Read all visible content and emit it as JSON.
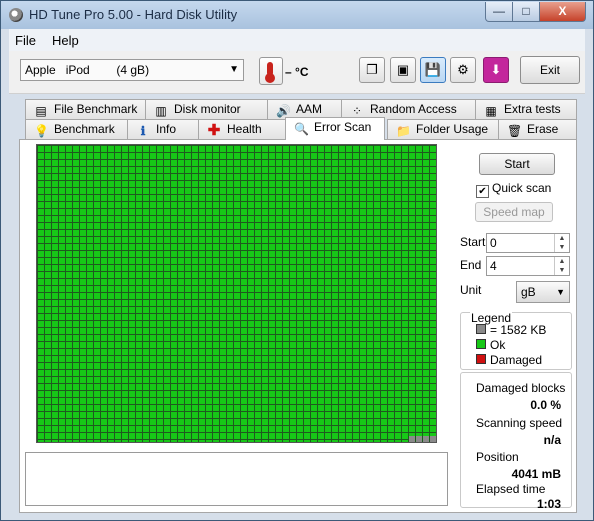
{
  "window": {
    "title": "HD Tune Pro 5.00 - Hard Disk Utility",
    "minimize": "—",
    "maximize": "□",
    "close": "X"
  },
  "menu": {
    "file": "File",
    "help": "Help"
  },
  "toolbar": {
    "drive": "Apple   iPod        (4 gB)",
    "temperature": "– ",
    "temperature_unit": "°C",
    "exit": "Exit"
  },
  "tabs_row1": [
    {
      "label": "File Benchmark",
      "icon": "file-benchmark-icon"
    },
    {
      "label": "Disk monitor",
      "icon": "disk-monitor-icon"
    },
    {
      "label": "AAM",
      "icon": "speaker-icon"
    },
    {
      "label": "Random Access",
      "icon": "random-access-icon"
    },
    {
      "label": "Extra tests",
      "icon": "extra-tests-icon"
    }
  ],
  "tabs_row2": [
    {
      "label": "Benchmark",
      "icon": "lightbulb-icon"
    },
    {
      "label": "Info",
      "icon": "info-icon"
    },
    {
      "label": "Health",
      "icon": "health-cross-icon"
    },
    {
      "label": "Error Scan",
      "icon": "magnifier-icon",
      "selected": true
    },
    {
      "label": "Folder Usage",
      "icon": "folder-icon"
    },
    {
      "label": "Erase",
      "icon": "trash-icon"
    }
  ],
  "scan": {
    "start_button": "Start",
    "quick_scan_label": "Quick scan",
    "quick_scan_checked": true,
    "speed_map_button": "Speed map",
    "start_label": "Start",
    "start_value": "0",
    "end_label": "End",
    "end_value": "4",
    "unit_label": "Unit",
    "unit_value": "gB",
    "grid_state": "Ok",
    "ok_color": "#17c817"
  },
  "legend": {
    "title": "Legend",
    "block_size": "= 1582 KB",
    "ok": "Ok",
    "damaged": "Damaged",
    "block_color": "#8a8a8a",
    "ok_color": "#17c817",
    "damaged_color": "#d01010"
  },
  "stats": {
    "damaged_blocks_label": "Damaged blocks",
    "damaged_blocks_value": "0.0 %",
    "scanning_speed_label": "Scanning speed",
    "scanning_speed_value": "n/a",
    "position_label": "Position",
    "position_value": "4041 mB",
    "elapsed_label": "Elapsed time",
    "elapsed_value": "1:03"
  }
}
